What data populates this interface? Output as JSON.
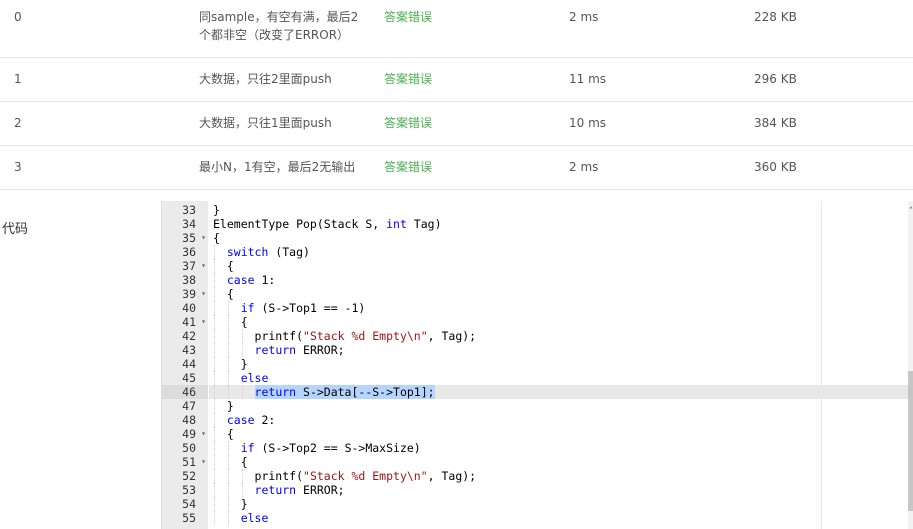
{
  "results": [
    {
      "index": "0",
      "desc": "同sample，有空有满，最后2个都非空（改变了ERROR）",
      "status": "答案错误",
      "time": "2 ms",
      "memory": "228 KB"
    },
    {
      "index": "1",
      "desc": "大数据，只往2里面push",
      "status": "答案错误",
      "time": "11 ms",
      "memory": "296 KB"
    },
    {
      "index": "2",
      "desc": "大数据，只往1里面push",
      "status": "答案错误",
      "time": "10 ms",
      "memory": "384 KB"
    },
    {
      "index": "3",
      "desc": "最小N，1有空，最后2无输出",
      "status": "答案错误",
      "time": "2 ms",
      "memory": "360 KB"
    }
  ],
  "code_label": "代码",
  "editor": {
    "active_line": "46",
    "lines": [
      {
        "num": "33",
        "fold": "",
        "text": "}"
      },
      {
        "num": "34",
        "fold": "",
        "text": "ElementType Pop(Stack S, int Tag)"
      },
      {
        "num": "35",
        "fold": "▾",
        "text": "{"
      },
      {
        "num": "36",
        "fold": "",
        "text": "  switch (Tag)"
      },
      {
        "num": "37",
        "fold": "▾",
        "text": "  {"
      },
      {
        "num": "38",
        "fold": "",
        "text": "  case 1:"
      },
      {
        "num": "39",
        "fold": "▾",
        "text": "  {"
      },
      {
        "num": "40",
        "fold": "",
        "text": "    if (S->Top1 == -1)"
      },
      {
        "num": "41",
        "fold": "▾",
        "text": "    {"
      },
      {
        "num": "42",
        "fold": "",
        "text": "      printf(\"Stack %d Empty\\n\", Tag);"
      },
      {
        "num": "43",
        "fold": "",
        "text": "      return ERROR;"
      },
      {
        "num": "44",
        "fold": "",
        "text": "    }"
      },
      {
        "num": "45",
        "fold": "",
        "text": "    else"
      },
      {
        "num": "46",
        "fold": "",
        "text": "      return S->Data[--S->Top1];"
      },
      {
        "num": "47",
        "fold": "",
        "text": "  }"
      },
      {
        "num": "48",
        "fold": "",
        "text": "  case 2:"
      },
      {
        "num": "49",
        "fold": "▾",
        "text": "  {"
      },
      {
        "num": "50",
        "fold": "",
        "text": "    if (S->Top2 == S->MaxSize)"
      },
      {
        "num": "51",
        "fold": "▾",
        "text": "    {"
      },
      {
        "num": "52",
        "fold": "",
        "text": "      printf(\"Stack %d Empty\\n\", Tag);"
      },
      {
        "num": "53",
        "fold": "",
        "text": "      return ERROR;"
      },
      {
        "num": "54",
        "fold": "",
        "text": "    }"
      },
      {
        "num": "55",
        "fold": "",
        "text": "    else"
      }
    ]
  },
  "colors": {
    "status_error": "#4caf50",
    "keyword": "#0000ff",
    "string": "#a31515",
    "selection": "#b5d5ff"
  },
  "icons": {
    "fold": "fold-arrow-icon",
    "scroll_up": "scroll-up-arrow-icon"
  }
}
